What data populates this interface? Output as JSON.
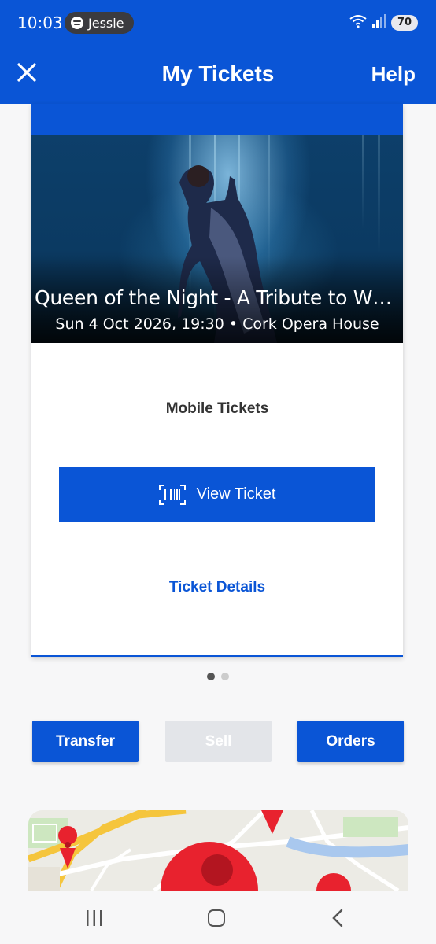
{
  "status_bar": {
    "time": "10:03",
    "spotify_user": "Jessie",
    "battery": "70"
  },
  "app_bar": {
    "title": "My Tickets",
    "help_label": "Help"
  },
  "ticket": {
    "event_title": "Queen of the Night - A Tribute to Whit…",
    "event_subtitle": "Sun 4 Oct 2026, 19:30 • Cork Opera House",
    "delivery_label": "Mobile Tickets",
    "view_ticket_label": "View Ticket",
    "details_label": "Ticket Details"
  },
  "pager": {
    "current": 1,
    "total": 2
  },
  "actions": {
    "transfer_label": "Transfer",
    "sell_label": "Sell",
    "orders_label": "Orders"
  },
  "colors": {
    "brand_blue": "#0a55d6",
    "disabled_gray": "#e3e5e9",
    "map_pin_red": "#e8222e"
  },
  "icons": {
    "close": "close-icon",
    "barcode": "barcode-icon",
    "wifi": "wifi-icon",
    "signal": "signal-icon",
    "nav_recent": "recent-apps-icon",
    "nav_home": "home-icon",
    "nav_back": "back-icon"
  }
}
